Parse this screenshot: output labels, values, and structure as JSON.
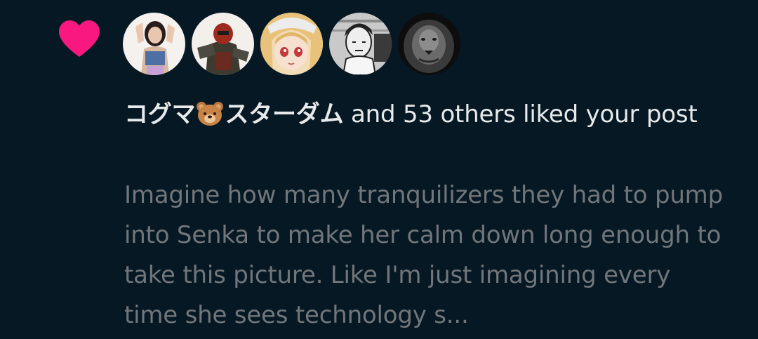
{
  "notification": {
    "type_icon": "heart-icon",
    "accent_color": "#f91880",
    "background_color": "#061823",
    "avatars": [
      {
        "icon": "avatar-woman-photo"
      },
      {
        "icon": "avatar-armored-figure"
      },
      {
        "icon": "avatar-anime-girl"
      },
      {
        "icon": "avatar-manga-man"
      },
      {
        "icon": "avatar-lion"
      }
    ],
    "liker_name_part1": "コグマ",
    "liker_name_emoji": "bear-face-emoji",
    "liker_name_part2": "スターダム",
    "liked_text": " and 53 others liked your post",
    "post_preview": "Imagine how many tranquilizers they had to pump into Senka to make her calm down long enough to take this picture. Like I'm just imagining every time she sees technology s..."
  }
}
